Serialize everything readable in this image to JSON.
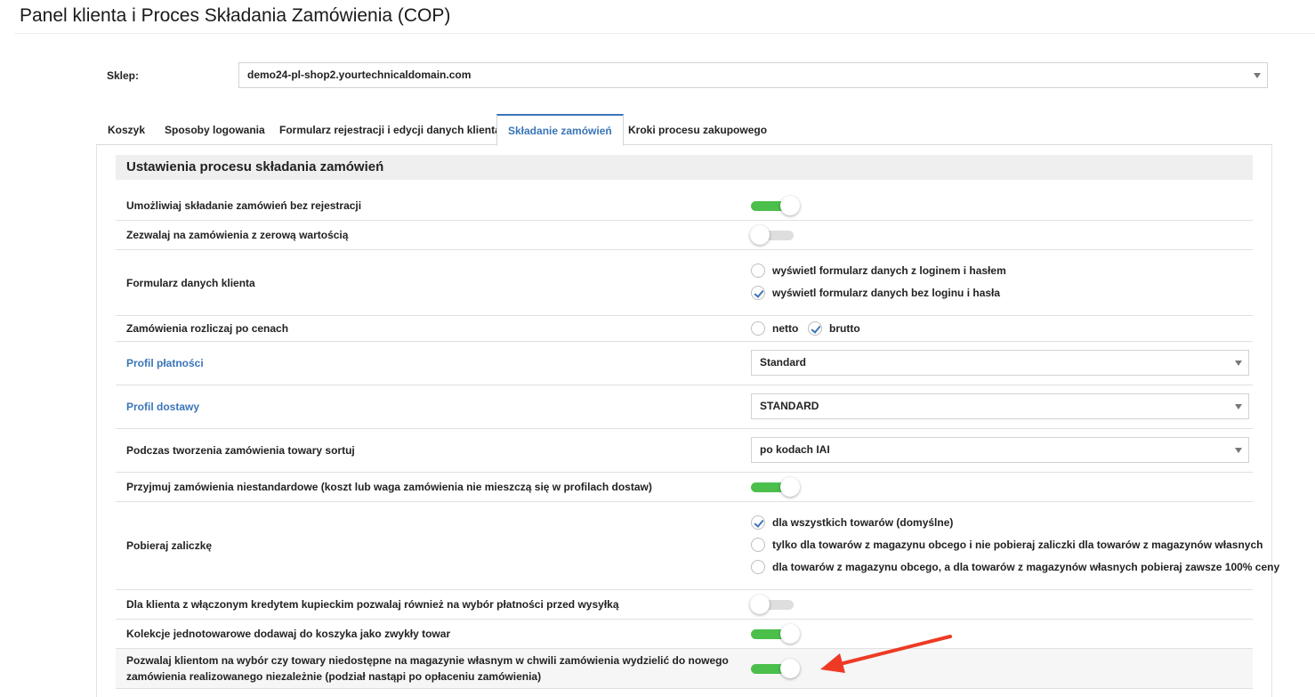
{
  "page": {
    "title": "Panel klienta i Proces Składania Zamówienia (COP)"
  },
  "shop": {
    "label": "Sklep:",
    "value": "demo24-pl-shop2.yourtechnicaldomain.com"
  },
  "tabs": [
    {
      "label": "Koszyk"
    },
    {
      "label": "Sposoby logowania"
    },
    {
      "label": "Formularz rejestracji i edycji danych klienta"
    },
    {
      "label": "Składanie zamówień"
    },
    {
      "label": "Kroki procesu zakupowego"
    }
  ],
  "active_tab": "Składanie zamówień",
  "section": {
    "title": "Ustawienia procesu składania zamówień"
  },
  "settings": {
    "no_registration": {
      "label": "Umożliwiaj składanie zamówień bez rejestracji",
      "enabled": true
    },
    "zero_value": {
      "label": "Zezwalaj na zamówienia z zerową wartością",
      "enabled": false
    },
    "customer_form": {
      "label": "Formularz danych klienta",
      "options": [
        {
          "label": "wyświetl formularz danych z loginem i hasłem",
          "checked": false
        },
        {
          "label": "wyświetl formularz danych bez loginu i hasła",
          "checked": true
        }
      ]
    },
    "prices": {
      "label": "Zamówienia rozliczaj po cenach",
      "options": [
        {
          "label": "netto",
          "checked": false
        },
        {
          "label": "brutto",
          "checked": true
        }
      ]
    },
    "payment_profile": {
      "label": "Profil płatności",
      "value": "Standard"
    },
    "delivery_profile": {
      "label": "Profil dostawy",
      "value": "STANDARD"
    },
    "sorting": {
      "label": "Podczas tworzenia zamówienia towary sortuj",
      "value": "po kodach IAI"
    },
    "nonstandard": {
      "label": "Przyjmuj zamówienia niestandardowe (koszt lub waga zamówienia nie mieszczą się w profilach dostaw)",
      "enabled": true
    },
    "deposit": {
      "label": "Pobieraj zaliczkę",
      "options": [
        {
          "label": "dla wszystkich towarów (domyślne)",
          "checked": true
        },
        {
          "label": "tylko dla towarów z magazynu obcego i nie pobieraj zaliczki dla towarów z magazynów własnych",
          "checked": false
        },
        {
          "label": "dla towarów z magazynu obcego, a dla towarów z magazynów własnych pobieraj zawsze 100% ceny",
          "checked": false
        }
      ]
    },
    "merchant_credit": {
      "label": "Dla klienta z włączonym kredytem kupieckim pozwalaj również na wybór płatności przed wysyłką",
      "enabled": false
    },
    "collections": {
      "label": "Kolekcje jednotowarowe dodawaj do koszyka jako zwykły towar",
      "enabled": true
    },
    "split_order": {
      "label_line1": "Pozwalaj klientom na wybór czy towary niedostępne na magazynie własnym w chwili zamówienia wydzielić do nowego",
      "label_line2": "zamówienia realizowanego niezależnie (podział nastąpi po opłaceniu zamówienia)",
      "enabled": true
    }
  },
  "colors": {
    "accent": "#3a75b8",
    "toggle_on": "#4bbf4b",
    "toggle_off": "#dedede",
    "annotation_arrow": "#ee3a25"
  }
}
